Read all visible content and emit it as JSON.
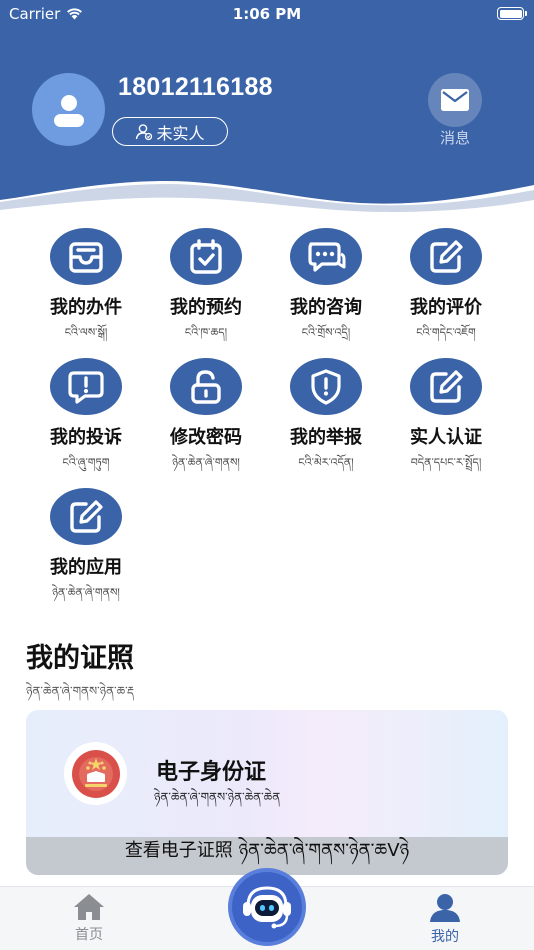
{
  "status_bar": {
    "carrier": "Carrier",
    "time": "1:06 PM"
  },
  "profile": {
    "phone": "18012116188",
    "verify_status": "未实人",
    "message_label": "消息"
  },
  "services": [
    {
      "label": "我的办件",
      "sub": "ངའི་ལས་སྒོ།",
      "icon": "inbox-icon"
    },
    {
      "label": "我的预约",
      "sub": "ངའི་ཁ་ཆད།",
      "icon": "calendar-check-icon"
    },
    {
      "label": "我的咨询",
      "sub": "ངའི་གྲོས་འདྲི།",
      "icon": "chat-bubbles-icon"
    },
    {
      "label": "我的评价",
      "sub": "ངའི་གདེང་འཇོག",
      "icon": "edit-icon"
    },
    {
      "label": "我的投诉",
      "sub": "ངའི་ཞུ་གཏུག",
      "icon": "alert-message-icon"
    },
    {
      "label": "修改密码",
      "sub": "ཉེན་ཆེན་ཞེ་གནས།",
      "icon": "unlock-icon"
    },
    {
      "label": "我的举报",
      "sub": "ངའི་མེར་འདོན།",
      "icon": "shield-alert-icon"
    },
    {
      "label": "实人认证",
      "sub": "བདེན་དཔང་ར་སྤྲོད།",
      "icon": "edit-icon"
    },
    {
      "label": "我的应用",
      "sub": "ཉེན་ཆེན་ཞེ་གནས།",
      "icon": "edit-icon"
    }
  ],
  "certificates": {
    "title": "我的证照",
    "sub": "ཉེན་ཆེན་ཞེ་གནས་ཉེན་ཆ་རྡ",
    "card_name": "电子身份证",
    "card_sub": "ཉེན་ཆེན་ཞེ་གནས་ཉེན་ཆེན་ཆེན",
    "view_label": "查看电子证照 ཉེན་ཆེན་ཞེ་གནས་ཉེན་ཆVཉེ"
  },
  "tabbar": {
    "home_label": "首页",
    "mine_label": "我的"
  },
  "colors": {
    "header_blue": "#3a63a8",
    "icon_blue": "#3a63a8",
    "tab_active": "#3a63a8"
  }
}
